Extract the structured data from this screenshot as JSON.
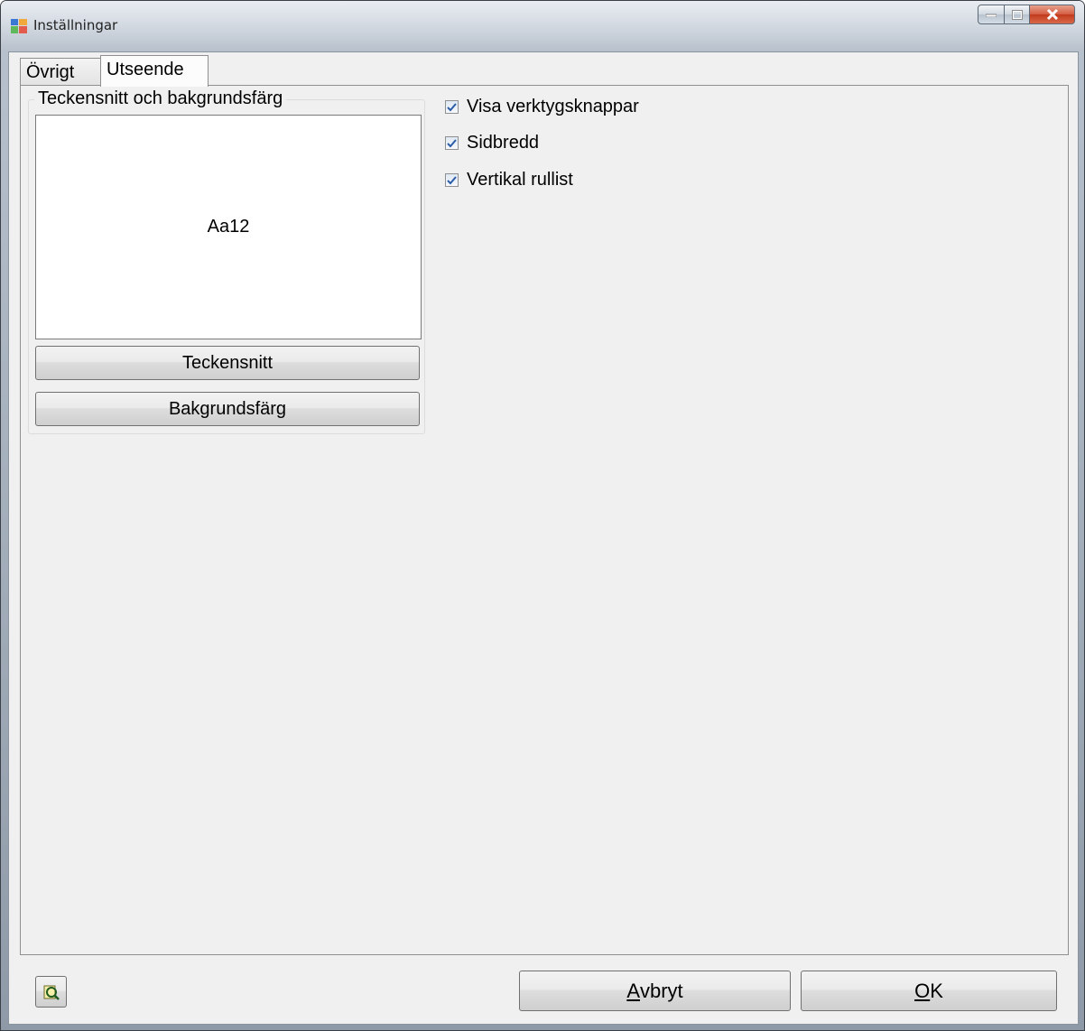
{
  "window": {
    "title": "Inställningar"
  },
  "tabs": [
    {
      "label": "Övrigt",
      "selected": false
    },
    {
      "label": "Utseende",
      "selected": true
    }
  ],
  "appearance": {
    "group_title": "Teckensnitt och bakgrundsfärg",
    "preview_text": "Aa12",
    "font_button": "Teckensnitt",
    "background_button": "Bakgrundsfärg",
    "checkboxes": [
      {
        "label": "Visa verktygsknappar",
        "checked": true
      },
      {
        "label": "Sidbredd",
        "checked": true
      },
      {
        "label": "Vertikal rullist",
        "checked": true
      }
    ]
  },
  "footer": {
    "help_icon": "help-search-icon",
    "cancel_accel": "A",
    "cancel_rest": "vbryt",
    "ok_accel": "O",
    "ok_rest": "K"
  },
  "colors": {
    "close_button": "#c23a1c",
    "checkmark": "#2a5ca8"
  }
}
